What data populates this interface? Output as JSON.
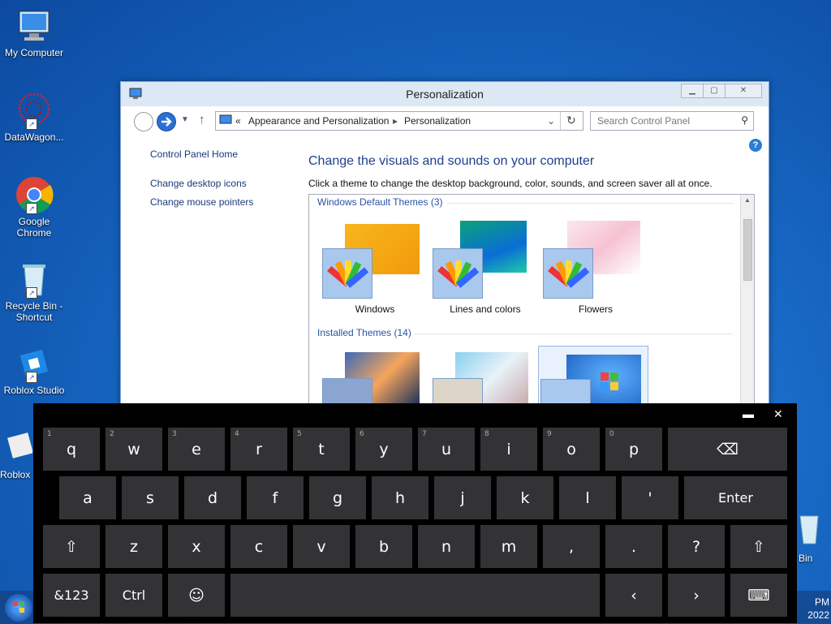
{
  "desktop": {
    "icons": [
      {
        "label": "My Computer"
      },
      {
        "label": "DataWagon..."
      },
      {
        "label": "Google Chrome"
      },
      {
        "label": "Recycle Bin - Shortcut"
      },
      {
        "label": "Roblox Studio"
      },
      {
        "label": "Roblox"
      },
      {
        "label": "Bin"
      }
    ]
  },
  "window": {
    "title": "Personalization",
    "address": {
      "prefix": "«",
      "crumb1": "Appearance and Personalization",
      "crumb2": "Personalization"
    },
    "search_placeholder": "Search Control Panel",
    "sidebar": {
      "home": "Control Panel Home",
      "links": [
        "Change desktop icons",
        "Change mouse pointers"
      ]
    },
    "heading": "Change the visuals and sounds on your computer",
    "description": "Click a theme to change the desktop background, color, sounds, and screen saver all at once.",
    "groups": [
      {
        "title": "Windows Default Themes (3)",
        "themes": [
          "Windows",
          "Lines and colors",
          "Flowers"
        ]
      },
      {
        "title": "Installed Themes (14)"
      }
    ]
  },
  "keyboard": {
    "rows": [
      [
        "q",
        "w",
        "e",
        "r",
        "t",
        "y",
        "u",
        "i",
        "o",
        "p"
      ],
      [
        "a",
        "s",
        "d",
        "f",
        "g",
        "h",
        "j",
        "k",
        "l",
        "'"
      ],
      [
        "z",
        "x",
        "c",
        "v",
        "b",
        "n",
        "m",
        ",",
        ".",
        "?"
      ]
    ],
    "row1_numbers": [
      "1",
      "2",
      "3",
      "4",
      "5",
      "6",
      "7",
      "8",
      "9",
      "0"
    ],
    "enter": "Enter",
    "symbols": "&123",
    "ctrl": "Ctrl",
    "shift_glyph": "⇧",
    "backspace_glyph": "⌫",
    "emoji_glyph": "☺",
    "left_glyph": "‹",
    "right_glyph": "›",
    "keyboard_glyph": "⌨",
    "dock_glyph": "▬",
    "close_glyph": "✕"
  },
  "taskbar": {
    "time_suffix": "PM",
    "year_fragment": "2022"
  },
  "colors": {
    "accent_link": "#1a3a78",
    "heading": "#1e3f8f",
    "key_bg": "#333336"
  }
}
